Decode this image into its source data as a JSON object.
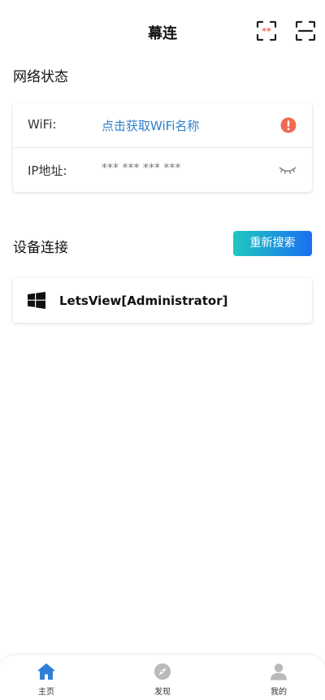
{
  "header": {
    "title": "幕连"
  },
  "network": {
    "section_title": "网络状态",
    "wifi_label": "WiFi:",
    "wifi_value": "点击获取WiFi名称",
    "ip_label": "IP地址:",
    "ip_value": "*** *** *** ***"
  },
  "devices": {
    "section_title": "设备连接",
    "search_label": "重新搜索",
    "items": [
      {
        "name": "LetsView[Administrator]",
        "icon": "windows-icon"
      }
    ]
  },
  "tabbar": {
    "items": [
      {
        "label": "主页",
        "icon": "home-icon",
        "active": true
      },
      {
        "label": "发现",
        "icon": "compass-icon",
        "active": false
      },
      {
        "label": "我的",
        "icon": "user-icon",
        "active": false
      }
    ]
  },
  "colors": {
    "accent_blue": "#2f7fc9",
    "warning_red": "#ee6a52",
    "gradient_start": "#1fc8c0",
    "gradient_end": "#1a6ff0",
    "active_tab": "#2f7fd8",
    "inactive_tab": "#b9b9b9"
  }
}
